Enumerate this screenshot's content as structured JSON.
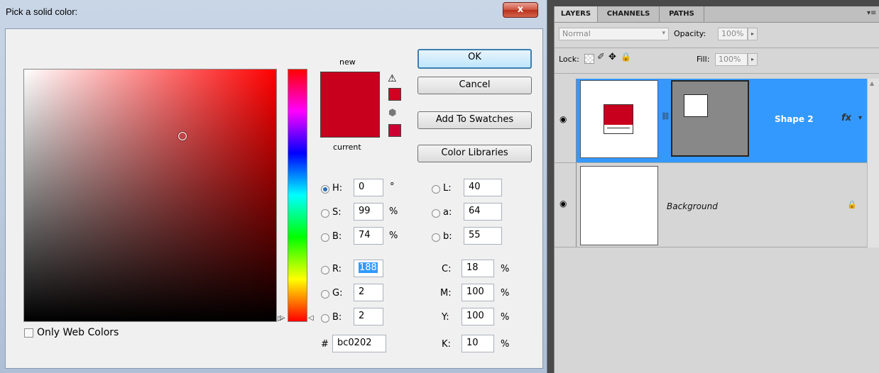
{
  "dialog": {
    "title": "Pick a solid color:",
    "close_glyph": "x",
    "labels": {
      "new": "new",
      "current": "current"
    },
    "new_color": "#c8001e",
    "current_color": "#c8001e",
    "buttons": {
      "ok": "OK",
      "cancel": "Cancel",
      "add_to_swatches": "Add To Swatches",
      "color_libraries": "Color Libraries"
    },
    "only_web_colors": {
      "label": "Only Web Colors",
      "checked": false
    },
    "hsb": [
      {
        "label": "H:",
        "value": "0",
        "unit": "°",
        "selected": true
      },
      {
        "label": "S:",
        "value": "99",
        "unit": "%",
        "selected": false
      },
      {
        "label": "B:",
        "value": "74",
        "unit": "%",
        "selected": false
      }
    ],
    "rgb": [
      {
        "label": "R:",
        "value": "188",
        "selected": false
      },
      {
        "label": "G:",
        "value": "2",
        "selected": false
      },
      {
        "label": "B:",
        "value": "2",
        "selected": false
      }
    ],
    "lab": [
      {
        "label": "L:",
        "value": "40"
      },
      {
        "label": "a:",
        "value": "64"
      },
      {
        "label": "b:",
        "value": "55"
      }
    ],
    "cmyk": [
      {
        "label": "C:",
        "value": "18",
        "unit": "%"
      },
      {
        "label": "M:",
        "value": "100",
        "unit": "%"
      },
      {
        "label": "Y:",
        "value": "100",
        "unit": "%"
      },
      {
        "label": "K:",
        "value": "10",
        "unit": "%"
      }
    ],
    "hex": {
      "label": "#",
      "value": "bc0202"
    }
  },
  "layers_panel": {
    "tabs": [
      "LAYERS",
      "CHANNELS",
      "PATHS"
    ],
    "blend_mode": "Normal",
    "opacity_label": "Opacity:",
    "opacity_value": "100%",
    "lock_label": "Lock:",
    "fill_label": "Fill:",
    "fill_value": "100%",
    "layers": [
      {
        "name": "Shape 2",
        "selected": true,
        "fx": "fx"
      },
      {
        "name": "Background",
        "selected": false,
        "locked": true
      }
    ]
  }
}
